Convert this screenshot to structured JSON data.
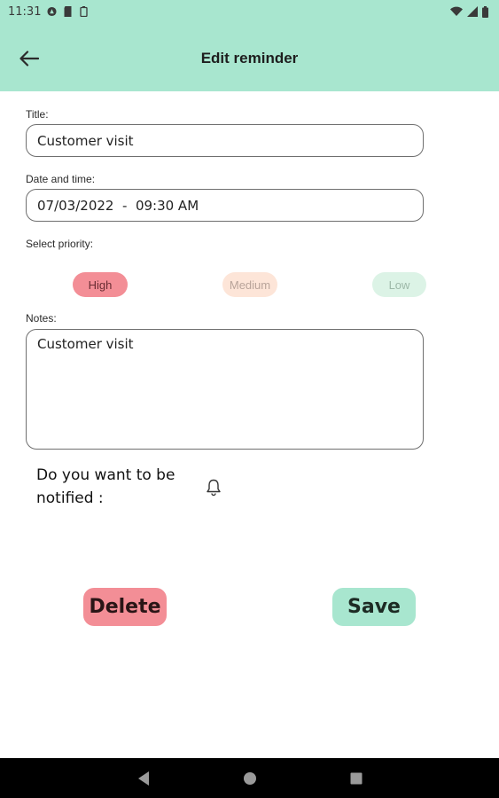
{
  "status_bar": {
    "time": "11:31"
  },
  "app_bar": {
    "title": "Edit reminder"
  },
  "form": {
    "title_label": "Title:",
    "title_value": "Customer visit",
    "datetime_label": "Date and time:",
    "datetime_value": "07/03/2022  -  09:30 AM",
    "priority_label": "Select priority:",
    "priority_options": [
      "High",
      "Medium",
      "Low"
    ],
    "priority_selected": "High",
    "notes_label": "Notes:",
    "notes_value": "Customer visit",
    "notify_question": "Do you want to be notified :"
  },
  "actions": {
    "delete_label": "Delete",
    "save_label": "Save"
  },
  "colors": {
    "accent_mint": "#a8e6cf",
    "delete_pink": "#f38e96",
    "medium_peach": "#fde5d8",
    "low_mint": "#dcf3e6"
  },
  "icons": {
    "back": "arrow-left-icon",
    "notify": "bell-icon",
    "nav_back": "triangle-back-icon",
    "nav_home": "circle-home-icon",
    "nav_recents": "square-recents-icon"
  }
}
